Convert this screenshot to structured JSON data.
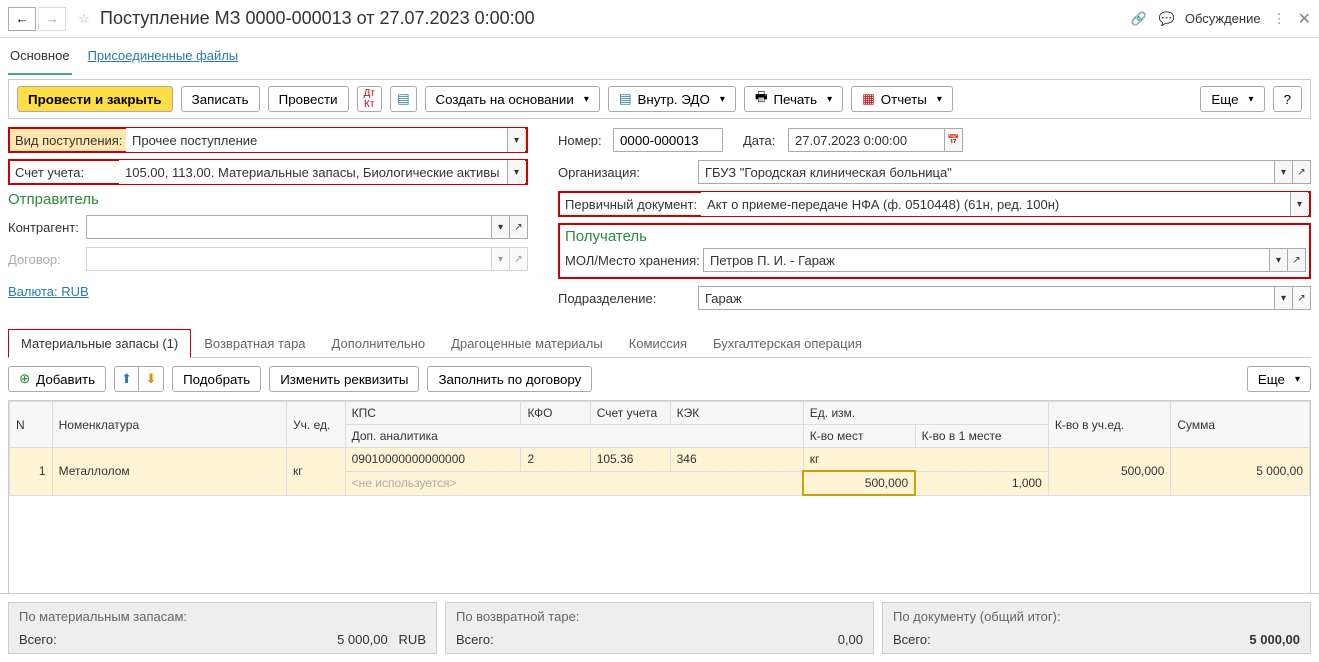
{
  "header": {
    "title": "Поступление МЗ 0000-000013 от 27.07.2023 0:00:00",
    "discussion": "Обсуждение"
  },
  "subtabs": {
    "main": "Основное",
    "files": "Присоединенные файлы"
  },
  "toolbar": {
    "post_close": "Провести и закрыть",
    "save": "Записать",
    "post": "Провести",
    "create_based": "Создать на основании",
    "edo": "Внутр. ЭДО",
    "print": "Печать",
    "reports": "Отчеты",
    "more": "Еще",
    "help": "?"
  },
  "form": {
    "kind_label": "Вид поступления:",
    "kind_value": "Прочее поступление",
    "account_label": "Счет учета:",
    "account_value": "105.00, 113.00. Материальные запасы, Биологические активы",
    "sender_title": "Отправитель",
    "counterparty_label": "Контрагент:",
    "contract_label": "Договор:",
    "currency_label": "Валюта: RUB",
    "number_label": "Номер:",
    "number_value": "0000-000013",
    "date_label": "Дата:",
    "date_value": "27.07.2023  0:00:00",
    "org_label": "Организация:",
    "org_value": "ГБУЗ \"Городская клиническая больница\"",
    "primary_doc_label": "Первичный документ:",
    "primary_doc_value": "Акт о приеме-передаче НФА (ф. 0510448) (61н, ред. 100н)",
    "recipient_title": "Получатель",
    "mol_label": "МОЛ/Место хранения:",
    "mol_value": "Петров П. И. - Гараж",
    "dept_label": "Подразделение:",
    "dept_value": "Гараж"
  },
  "tabs": {
    "materials": "Материальные запасы (1)",
    "tare": "Возвратная тара",
    "extra": "Дополнительно",
    "precious": "Драгоценные материалы",
    "commission": "Комиссия",
    "accounting": "Бухгалтерская операция"
  },
  "subtoolbar": {
    "add": "Добавить",
    "pick": "Подобрать",
    "edit_req": "Изменить реквизиты",
    "fill_contract": "Заполнить по договору",
    "more": "Еще"
  },
  "grid": {
    "headers": {
      "n": "N",
      "nom": "Номенклатура",
      "uched": "Уч. ед.",
      "kps": "КПС",
      "kfo": "КФО",
      "acct": "Счет учета",
      "kek": "КЭК",
      "edizm": "Ед. изм.",
      "kvouch": "К-во в уч.ед.",
      "summa": "Сумма",
      "dop": "Доп. аналитика",
      "kvomest": "К-во мест",
      "kvo1mest": "К-во в 1 месте"
    },
    "row1": {
      "n": "1",
      "nom": "Металлолом",
      "uched": "кг",
      "kps": "09010000000000000",
      "kfo": "2",
      "acct": "105.36",
      "kek": "346",
      "edizm": "кг",
      "kvouch": "500,000",
      "summa": "5 000,00",
      "dop": "<не используется>",
      "kvomest": "500,000",
      "kvo1mest": "1,000"
    }
  },
  "footer": {
    "materials_title": "По материальным запасам:",
    "tare_title": "По возвратной таре:",
    "doc_title": "По документу (общий итог):",
    "total_label": "Всего:",
    "materials_total": "5 000,00",
    "materials_cur": "RUB",
    "tare_total": "0,00",
    "doc_total": "5 000,00"
  }
}
